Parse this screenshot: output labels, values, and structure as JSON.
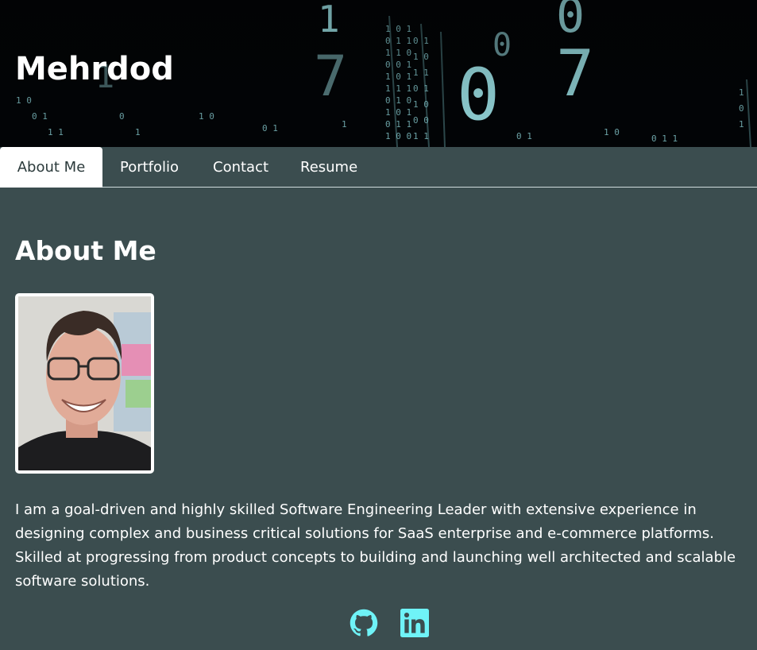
{
  "header": {
    "site_title": "Mehrdod"
  },
  "nav": {
    "tabs": [
      {
        "label": "About Me",
        "active": true
      },
      {
        "label": "Portfolio",
        "active": false
      },
      {
        "label": "Contact",
        "active": false
      },
      {
        "label": "Resume",
        "active": false
      }
    ]
  },
  "main": {
    "heading": "About Me",
    "bio": "I am a goal-driven and highly skilled Software Engineering Leader with extensive experience in designing complex and business critical solutions for SaaS enterprise and e-commerce platforms. Skilled at progressing from product concepts to building and launching well architected and scalable software solutions."
  },
  "social": {
    "icons": [
      "github-icon",
      "linkedin-icon"
    ]
  },
  "colors": {
    "background": "#3b4d4f",
    "accent": "#6ff3f7",
    "text": "#ffffff"
  }
}
